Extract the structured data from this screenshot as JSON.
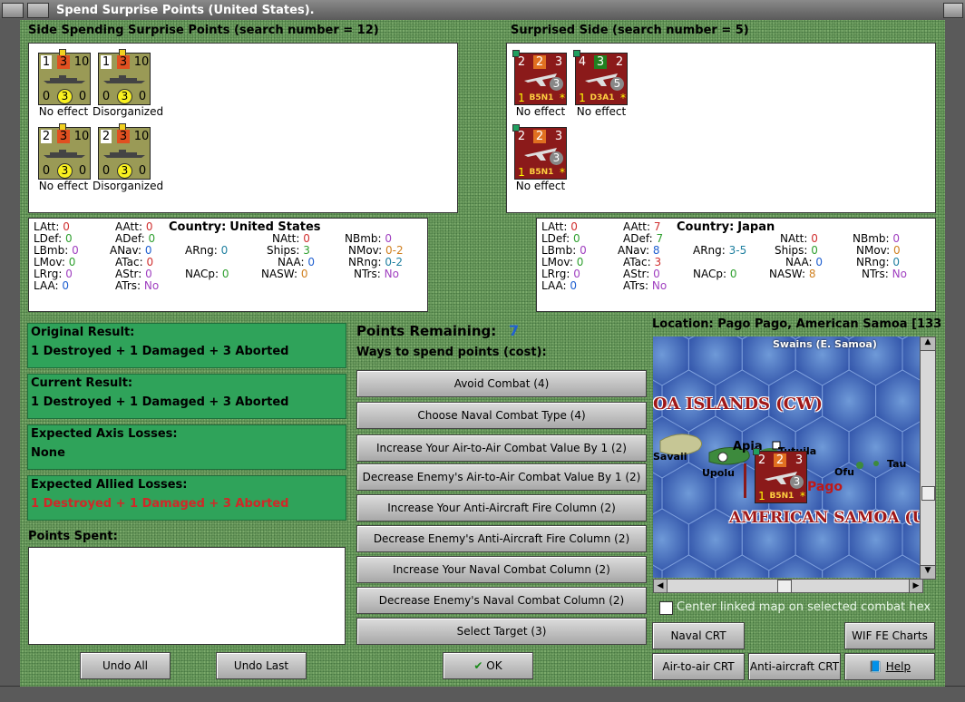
{
  "window": {
    "title": "Spend Surprise Points (United States)."
  },
  "left_side": {
    "header": "Side Spending Surprise Points (search number = 12)",
    "counters": [
      {
        "tl": "1",
        "tc": "3",
        "tr": "10",
        "bl": "0",
        "bc": "3",
        "br": "0",
        "caption": "No effect"
      },
      {
        "tl": "1",
        "tc": "3",
        "tr": "10",
        "bl": "0",
        "bc": "3",
        "br": "0",
        "caption": "Disorganized"
      },
      {
        "tl": "2",
        "tc": "3",
        "tr": "10",
        "bl": "0",
        "bc": "3",
        "br": "0",
        "caption": "No effect"
      },
      {
        "tl": "2",
        "tc": "3",
        "tr": "10",
        "bl": "0",
        "bc": "3",
        "br": "0",
        "caption": "Disorganized"
      }
    ]
  },
  "right_side": {
    "header": "Surprised Side (search number = 5)",
    "counters": [
      {
        "tl": "2",
        "tc": "2",
        "tr": "3",
        "circ": "3",
        "bl": "1",
        "name": "B5N1",
        "star": "*",
        "caption": "No effect"
      },
      {
        "tl": "4",
        "tc": "3",
        "tr": "2",
        "circ": "5",
        "bl": "1",
        "name": "D3A1",
        "star": "*",
        "caption": "No effect"
      },
      {
        "tl": "2",
        "tc": "2",
        "tr": "3",
        "circ": "3",
        "bl": "1",
        "name": "B5N1",
        "star": "*",
        "caption": "No effect"
      }
    ]
  },
  "us_stats": {
    "country_label": "Country:",
    "country": "United States",
    "LAtt": "0",
    "LDef": "0",
    "LBmb": "0",
    "LMov": "0",
    "LRrg": "0",
    "LAA": "0",
    "AAtt": "0",
    "ADef": "0",
    "ANav": "0",
    "ATac": "0",
    "AStr": "0",
    "ATrs": "No",
    "ARng": "0",
    "NACp": "0",
    "NAtt": "0",
    "Ships": "3",
    "NAA": "0",
    "NASW": "0",
    "NBmb": "0",
    "NMov": "0-2",
    "NRng": "0-2",
    "NTrs": "No"
  },
  "jp_stats": {
    "country_label": "Country:",
    "country": "Japan",
    "LAtt": "0",
    "LDef": "0",
    "LBmb": "0",
    "LMov": "0",
    "LRrg": "0",
    "LAA": "0",
    "AAtt": "7",
    "ADef": "7",
    "ANav": "8",
    "ATac": "3",
    "AStr": "0",
    "ATrs": "No",
    "ARng": "3-5",
    "NACp": "0",
    "NAtt": "0",
    "Ships": "0",
    "NAA": "0",
    "NASW": "8",
    "NBmb": "0",
    "NMov": "0",
    "NRng": "0",
    "NTrs": "No"
  },
  "results": {
    "original_label": "Original Result:",
    "original": "1 Destroyed + 1 Damaged + 3 Aborted",
    "current_label": "Current Result:",
    "current": "1 Destroyed + 1 Damaged + 3 Aborted",
    "axis_label": "Expected Axis Losses:",
    "axis": "None",
    "allied_label": "Expected Allied Losses:",
    "allied": "1 Destroyed + 1 Damaged + 3 Aborted",
    "spent_label": "Points Spent:"
  },
  "points": {
    "remaining_label": "Points Remaining:",
    "remaining": "7",
    "ways_label": "Ways to spend points (cost):"
  },
  "options": [
    "Avoid Combat (4)",
    "Choose Naval Combat Type (4)",
    "Increase Your Air-to-Air Combat Value By 1 (2)",
    "Decrease Enemy's Air-to-Air Combat Value By 1 (2)",
    "Increase Your Anti-Aircraft Fire Column (2)",
    "Decrease Enemy's Anti-Aircraft Fire Column (2)",
    "Increase Your Naval Combat Column (2)",
    "Decrease Enemy's Naval Combat Column (2)",
    "Select Target (3)"
  ],
  "map": {
    "location": "Location: Pago Pago, American Samoa [133,",
    "swains": "Swains (E. Samoa)",
    "samoa_islands": "OA ISLANDS (CW)",
    "american_samoa": "AMERICAN SAMOA (U",
    "apia": "Apia",
    "tutuila": "Tutuila",
    "upolu": "Upolu",
    "savaii": "Savaii",
    "pago": "Pago",
    "ofu": "Ofu",
    "tau": "Tau",
    "counter": {
      "tl": "2",
      "tc": "2",
      "tr": "3",
      "circ": "3",
      "bl": "1",
      "name": "B5N1",
      "star": "*"
    },
    "center_checkbox": "Center linked map on selected combat hex"
  },
  "buttons": {
    "undo_all": "Undo All",
    "undo_last": "Undo Last",
    "ok": "OK",
    "naval_crt": "Naval CRT",
    "wif_charts": "WIF FE Charts",
    "air_crt": "Air-to-air CRT",
    "aa_crt": "Anti-aircraft CRT",
    "help": "Help"
  },
  "colors": {
    "accent_green": "#2fa35a",
    "loss_red": "#d02828",
    "points_blue": "#2060d0"
  }
}
